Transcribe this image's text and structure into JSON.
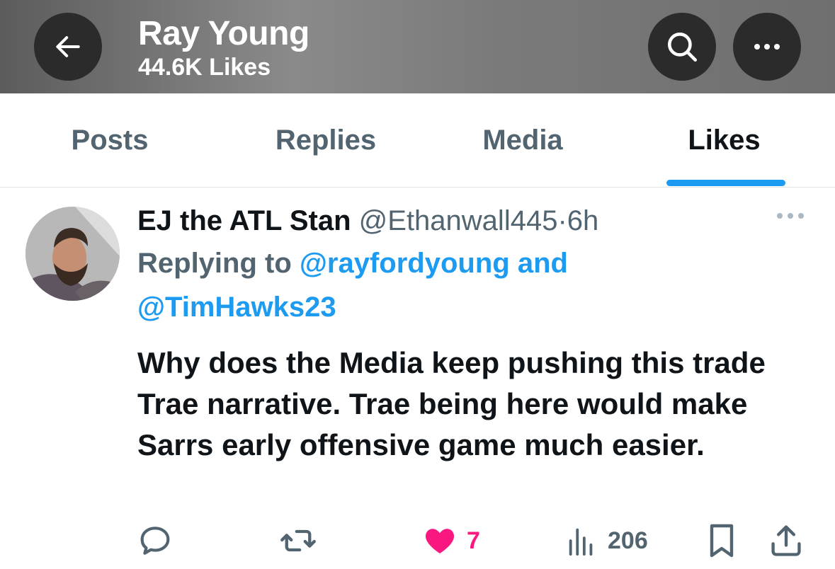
{
  "header": {
    "title": "Ray Young",
    "subtitle": "44.6K Likes",
    "icons": {
      "back": "arrow-left-icon",
      "search": "search-icon",
      "more": "more-horizontal-icon"
    }
  },
  "tabs": [
    {
      "label": "Posts",
      "active": false
    },
    {
      "label": "Replies",
      "active": false
    },
    {
      "label": "Media",
      "active": false
    },
    {
      "label": "Likes",
      "active": true
    }
  ],
  "tweet": {
    "author_name": "EJ the ATL Stan",
    "author_handle": "@Ethanwall445",
    "separator": "·",
    "time": "6h",
    "replying_prefix": "Replying to",
    "mention_1": "@rayfordyoung",
    "conjunction": "and",
    "mention_2": "@TimHawks23",
    "text": "Why does the Media keep pushing this trade Trae narrative. Trae being here would make Sarrs early offensive game much easier.",
    "actions": {
      "reply_icon": "comment-icon",
      "repost_icon": "repost-icon",
      "like_icon": "heart-filled-icon",
      "like_count": "7",
      "views_icon": "analytics-icon",
      "views_count": "206",
      "bookmark_icon": "bookmark-icon",
      "share_icon": "share-icon"
    }
  },
  "colors": {
    "accent": "#1d9bf0",
    "like": "#f91880",
    "secondary_text": "#536471",
    "primary_text": "#0f1419"
  }
}
